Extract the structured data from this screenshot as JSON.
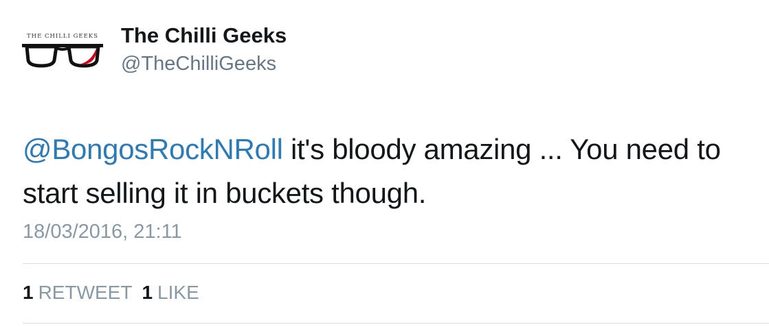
{
  "tweet": {
    "author": {
      "avatar_text": "THE CHILLI GEEKS",
      "display_name": "The Chilli Geeks",
      "handle": "@TheChilliGeeks"
    },
    "text": {
      "mention": "@BongosRockNRoll",
      "body": " it's bloody amazing ... You need to start selling it in buckets though."
    },
    "timestamp": "18/03/2016, 21:11",
    "stats": {
      "retweets_count": "1",
      "retweets_label": "RETWEET",
      "likes_count": "1",
      "likes_label": "LIKE"
    }
  },
  "colors": {
    "mention": "#2b7bb9",
    "secondary_text": "#8899a6",
    "handle": "#657786",
    "avatar_accent": "#d0021b"
  }
}
